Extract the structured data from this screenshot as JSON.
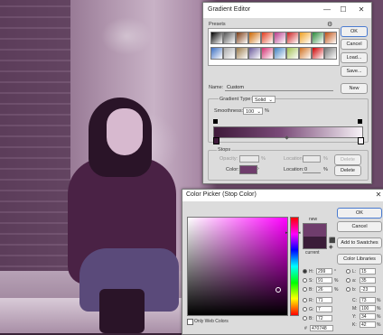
{
  "gradient_editor": {
    "title": "Gradient Editor",
    "window_controls": {
      "minimize": "—",
      "maximize": "☐",
      "close": "✕"
    },
    "presets_label": "Presets",
    "presets_menu_icon": "gear-icon",
    "buttons": {
      "ok": "OK",
      "cancel": "Cancel",
      "load": "Load...",
      "save": "Save...",
      "new": "New"
    },
    "name_label": "Name:",
    "name_value": "Custom",
    "gradient_type_label": "Gradient Type:",
    "gradient_type_value": "Solid",
    "smoothness_label": "Smoothness:",
    "smoothness_value": "100",
    "smoothness_unit": "%",
    "stops_label": "Stops",
    "opacity_label": "Opacity:",
    "opacity_unit": "%",
    "location_label": "Location:",
    "location_unit": "%",
    "delete_label": "Delete",
    "color_label": "Color:",
    "color_value": "#6f3d6c",
    "color_location_value": "0",
    "gradient_colors": [
      "#3e1a3a",
      "#7a4a78",
      "#f7f2f7"
    ],
    "preset_swatches": [
      "#000000",
      "#555555",
      "#7a3a12",
      "#cc6600",
      "#e23a1c",
      "#b83a8a",
      "#cc2222",
      "#f0a020",
      "#2a8a3a",
      "#c05010",
      "#3b6dc0",
      "#aaaaaa",
      "#9a7a4a",
      "#6a5a9a",
      "#d23070",
      "#4080c0",
      "#a0c050",
      "#d07020",
      "#cc0000",
      "#777777"
    ]
  },
  "color_picker": {
    "title": "Color Picker (Stop Color)",
    "close_icon": "close-icon",
    "new_label": "new",
    "current_label": "current",
    "new_color": "#6f3d6c",
    "current_color": "#3a1c38",
    "buttons": {
      "ok": "OK",
      "cancel": "Cancel",
      "add_to_swatches": "Add to Swatches",
      "color_libraries": "Color Libraries"
    },
    "only_web_colors": "Only Web Colors",
    "fields": {
      "H": {
        "label": "H:",
        "value": "299",
        "unit": "°"
      },
      "S": {
        "label": "S:",
        "value": "91",
        "unit": "%"
      },
      "B": {
        "label": "B:",
        "value": "26",
        "unit": "%"
      },
      "R": {
        "label": "R:",
        "value": "71"
      },
      "G": {
        "label": "G:",
        "value": "7"
      },
      "Bb": {
        "label": "B:",
        "value": "72"
      },
      "L": {
        "label": "L:",
        "value": "15"
      },
      "a": {
        "label": "a:",
        "value": "35"
      },
      "b": {
        "label": "b:",
        "value": "-23"
      },
      "C": {
        "label": "C:",
        "value": "73",
        "unit": "%"
      },
      "M": {
        "label": "M:",
        "value": "100",
        "unit": "%"
      },
      "Y": {
        "label": "Y:",
        "value": "34",
        "unit": "%"
      },
      "K": {
        "label": "K:",
        "value": "42",
        "unit": "%"
      },
      "hex_label": "#",
      "hex_value": "470748"
    }
  }
}
